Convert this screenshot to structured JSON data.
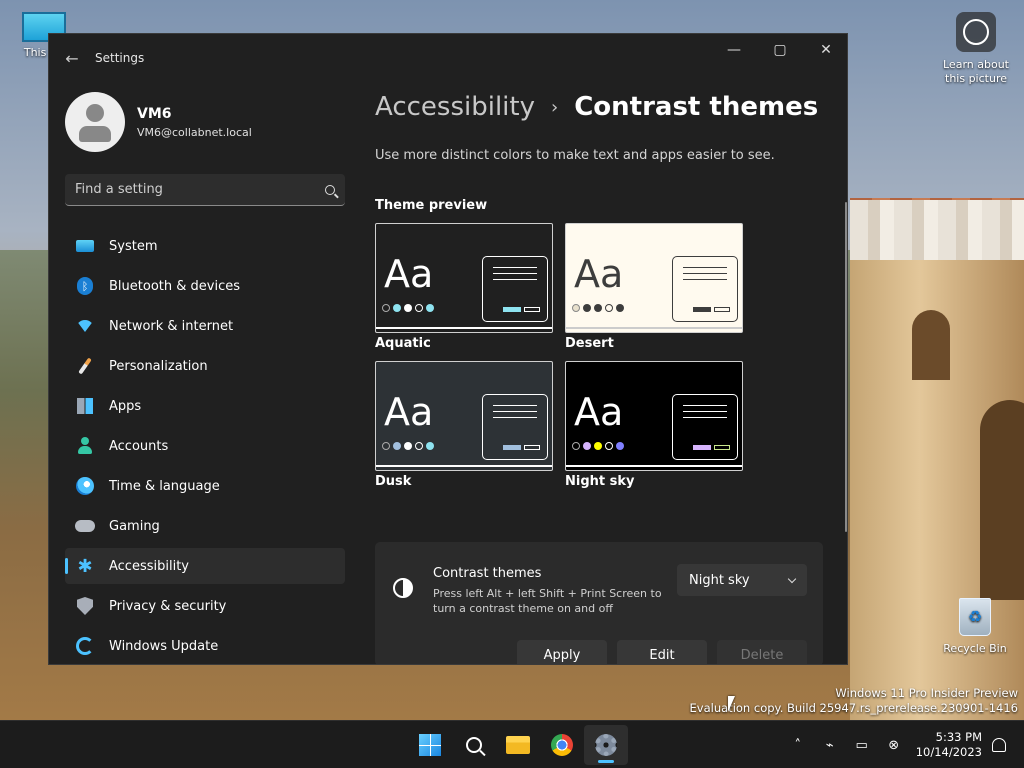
{
  "desktop": {
    "pc_label": "This PC",
    "learn_label": "Learn about this picture",
    "recycle_label": "Recycle Bin",
    "watermark_line1": "Windows 11 Pro Insider Preview",
    "watermark_line2": "Evaluation copy. Build 25947.rs_prerelease.230901-1416"
  },
  "window": {
    "title": "Settings",
    "back_icon": "←",
    "minimize_icon": "—",
    "maximize_icon": "▢",
    "close_icon": "✕"
  },
  "profile": {
    "name": "VM6",
    "email": "VM6@collabnet.local"
  },
  "search": {
    "placeholder": "Find a setting"
  },
  "nav": {
    "items": [
      {
        "label": "System"
      },
      {
        "label": "Bluetooth & devices"
      },
      {
        "label": "Network & internet"
      },
      {
        "label": "Personalization"
      },
      {
        "label": "Apps"
      },
      {
        "label": "Accounts"
      },
      {
        "label": "Time & language"
      },
      {
        "label": "Gaming"
      },
      {
        "label": "Accessibility"
      },
      {
        "label": "Privacy & security"
      },
      {
        "label": "Windows Update"
      }
    ],
    "active": "Accessibility"
  },
  "content": {
    "breadcrumb_parent": "Accessibility",
    "breadcrumb_sep": "›",
    "breadcrumb_current": "Contrast themes",
    "description": "Use more distinct colors to make text and apps easier to see.",
    "preview_label": "Theme preview",
    "themes": [
      {
        "name": "Aquatic",
        "aa": "Aa",
        "dots": [
          "#000000",
          "#8ee3f0",
          "#ffffff",
          "#000000",
          "#8ee3f0"
        ],
        "accent": "#8ee3f0"
      },
      {
        "name": "Desert",
        "aa": "Aa",
        "dots": [
          "#e8e0cc",
          "#3d3d3d",
          "#3d3d3d",
          "#fffaef",
          "#3d3d3d"
        ],
        "accent": "#3d3d3d"
      },
      {
        "name": "Dusk",
        "aa": "Aa",
        "dots": [
          "#2d3236",
          "#a1bfde",
          "#ffffff",
          "#2d3236",
          "#8ee3f0"
        ],
        "accent": "#a1bfde"
      },
      {
        "name": "Night sky",
        "aa": "Aa",
        "dots": [
          "#000000",
          "#d6b4fd",
          "#ffff00",
          "#000000",
          "#8080ff"
        ],
        "accent": "#d6b4fd"
      }
    ],
    "card": {
      "title": "Contrast themes",
      "subtitle": "Press left Alt + left Shift + Print Screen to turn a contrast theme on and off",
      "selected_theme": "Night sky",
      "apply_label": "Apply",
      "edit_label": "Edit",
      "delete_label": "Delete"
    }
  },
  "taskbar": {
    "time": "5:33 PM",
    "date": "10/14/2023",
    "tray_chevron": "˄"
  },
  "colors": {
    "accent": "#4cc2ff",
    "window_bg": "#202020"
  }
}
